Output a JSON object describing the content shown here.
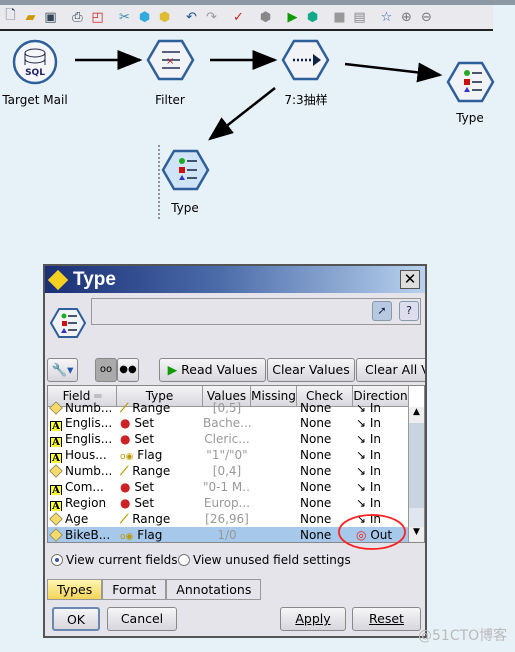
{
  "toolbar": {
    "icons": [
      "new-file-icon",
      "open-folder-icon",
      "save-icon",
      "print-icon",
      "windows-icon",
      "cut-icon",
      "copy-node-icon",
      "paste-icon",
      "undo-icon",
      "redo-icon",
      "check-icon",
      "sql-icon",
      "run-icon",
      "run-selection-icon",
      "stop-icon",
      "palette-icon",
      "favorite-icon",
      "zoom-in-icon",
      "zoom-out-icon"
    ]
  },
  "stream": {
    "nodes": [
      {
        "label": "Target Mail"
      },
      {
        "label": "Filter"
      },
      {
        "label": "7:3抽样"
      },
      {
        "label": "Type"
      },
      {
        "label": "Type"
      }
    ],
    "sql_text": "SQL"
  },
  "dialog": {
    "title": "Type",
    "buttons": {
      "read_values": "Read Values",
      "clear_values": "Clear Values",
      "clear_all": "Clear All Va"
    },
    "columns": [
      "Field",
      "Type",
      "Values",
      "Missing",
      "Check",
      "Direction"
    ],
    "rows": [
      {
        "field": "Numb...",
        "type": "Range",
        "values": "[0,5]",
        "missing": "",
        "check": "None",
        "direction": "In",
        "partial": true
      },
      {
        "field": "Englis...",
        "type": "Set",
        "values": "Bache...",
        "missing": "",
        "check": "None",
        "direction": "In"
      },
      {
        "field": "Englis...",
        "type": "Set",
        "values": "Cleric...",
        "missing": "",
        "check": "None",
        "direction": "In"
      },
      {
        "field": "Hous...",
        "type": "Flag",
        "values": "\"1\"/\"0\"",
        "missing": "",
        "check": "None",
        "direction": "In"
      },
      {
        "field": "Numb...",
        "type": "Range",
        "values": "[0,4]",
        "missing": "",
        "check": "None",
        "direction": "In"
      },
      {
        "field": "Com...",
        "type": "Set",
        "values": "\"0-1 M...",
        "missing": "",
        "check": "None",
        "direction": "In"
      },
      {
        "field": "Region",
        "type": "Set",
        "values": "Europ...",
        "missing": "",
        "check": "None",
        "direction": "In"
      },
      {
        "field": "Age",
        "type": "Range",
        "values": "[26,96]",
        "missing": "",
        "check": "None",
        "direction": "In"
      },
      {
        "field": "BikeB...",
        "type": "Flag",
        "values": "1/0",
        "missing": "",
        "check": "None",
        "direction": "Out",
        "selected": true
      }
    ],
    "radio": {
      "current": "View current fields",
      "unused": "View unused field settings",
      "selected": "current"
    },
    "tabs": [
      "Types",
      "Format",
      "Annotations"
    ],
    "active_tab": "Types",
    "footer": {
      "ok": "OK",
      "cancel": "Cancel",
      "apply": "Apply",
      "reset": "Reset"
    }
  },
  "watermark": "@51CTO博客",
  "colors": {
    "annotation_circle": "#ff2020",
    "selected_row": "#a6c8ea",
    "title_gradient_start": "#1a2f75"
  }
}
